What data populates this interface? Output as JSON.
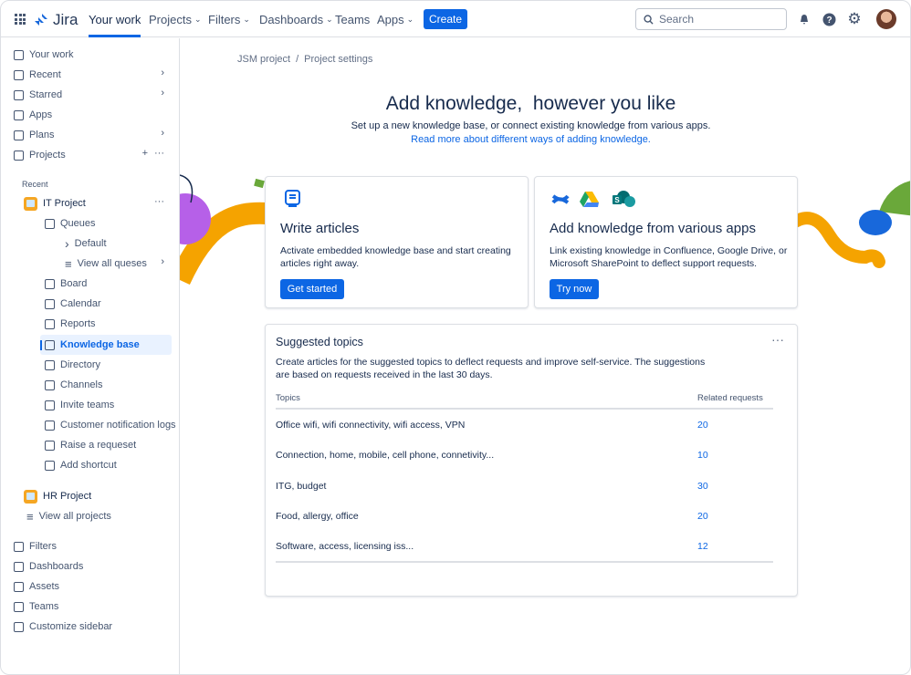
{
  "header": {
    "logo": "Jira",
    "nav": [
      {
        "label": "Your work"
      },
      {
        "label": "Projects"
      },
      {
        "label": "Filters"
      },
      {
        "label": "Dashboards"
      },
      {
        "label": "Teams"
      },
      {
        "label": "Apps"
      }
    ],
    "create": "Create",
    "search_placeholder": "Search"
  },
  "sidebar": {
    "top": [
      {
        "label": "Your work",
        "icon": "your-work-icon"
      },
      {
        "label": "Recent",
        "icon": "clock-icon"
      },
      {
        "label": "Starred",
        "icon": "star-icon"
      },
      {
        "label": "Apps",
        "icon": "apps-icon"
      },
      {
        "label": "Plans",
        "icon": "plans-icon"
      },
      {
        "label": "Projects",
        "icon": "rocket-icon"
      }
    ],
    "recent_heading": "Recent",
    "it_project": "IT Project",
    "project_items": [
      {
        "label": "Queues"
      },
      {
        "label": "Default"
      },
      {
        "label": "View all queses"
      },
      {
        "label": "Board"
      },
      {
        "label": "Calendar"
      },
      {
        "label": "Reports"
      },
      {
        "label": "Knowledge base"
      },
      {
        "label": "Directory"
      },
      {
        "label": "Channels"
      },
      {
        "label": "Invite teams"
      },
      {
        "label": "Customer notification logs"
      },
      {
        "label": "Raise a requeset"
      },
      {
        "label": "Add shortcut"
      }
    ],
    "hr_project": "HR Project",
    "view_all_projects": "View all projects",
    "bottom": [
      {
        "label": "Filters"
      },
      {
        "label": "Dashboards"
      },
      {
        "label": "Assets"
      },
      {
        "label": "Teams"
      },
      {
        "label": "Customize sidebar"
      }
    ]
  },
  "breadcrumb": {
    "project": "JSM project",
    "sep": "/",
    "page": "Project settings"
  },
  "hero": {
    "title": "Add knowledge,  however you like",
    "subtitle": "Set up a new knowledge base, or connect existing knowledge from various apps.",
    "link": "Read more about different ways of adding knowledge."
  },
  "cards": [
    {
      "title": "Write articles",
      "desc": "Activate embedded knowledge base and start creating articles right away.",
      "button": "Get started"
    },
    {
      "title": "Add knowledge from various apps",
      "desc": "Link existing knowledge in Confluence, Google Drive, or Microsoft SharePoint to deflect support requests.",
      "button": "Try now"
    }
  ],
  "topics": {
    "title": "Suggested topics",
    "desc": "Create articles for the suggested topics to deflect requests and improve self-service. The suggestions are based on requests received in the last 30 days.",
    "col_topics": "Topics",
    "col_related": "Related requests",
    "rows": [
      {
        "topic": "Office wifi, wifi connectivity, wifi access, VPN",
        "count": "20"
      },
      {
        "topic": "Connection, home, mobile, cell phone, connetivity...",
        "count": "10"
      },
      {
        "topic": "ITG, budget",
        "count": "30"
      },
      {
        "topic": "Food, allergy, office",
        "count": "20"
      },
      {
        "topic": "Software, access, licensing iss...",
        "count": "12"
      }
    ]
  },
  "colors": {
    "brand": "#0c66e4",
    "orange": "#f5a300",
    "purple": "#b660e8"
  }
}
